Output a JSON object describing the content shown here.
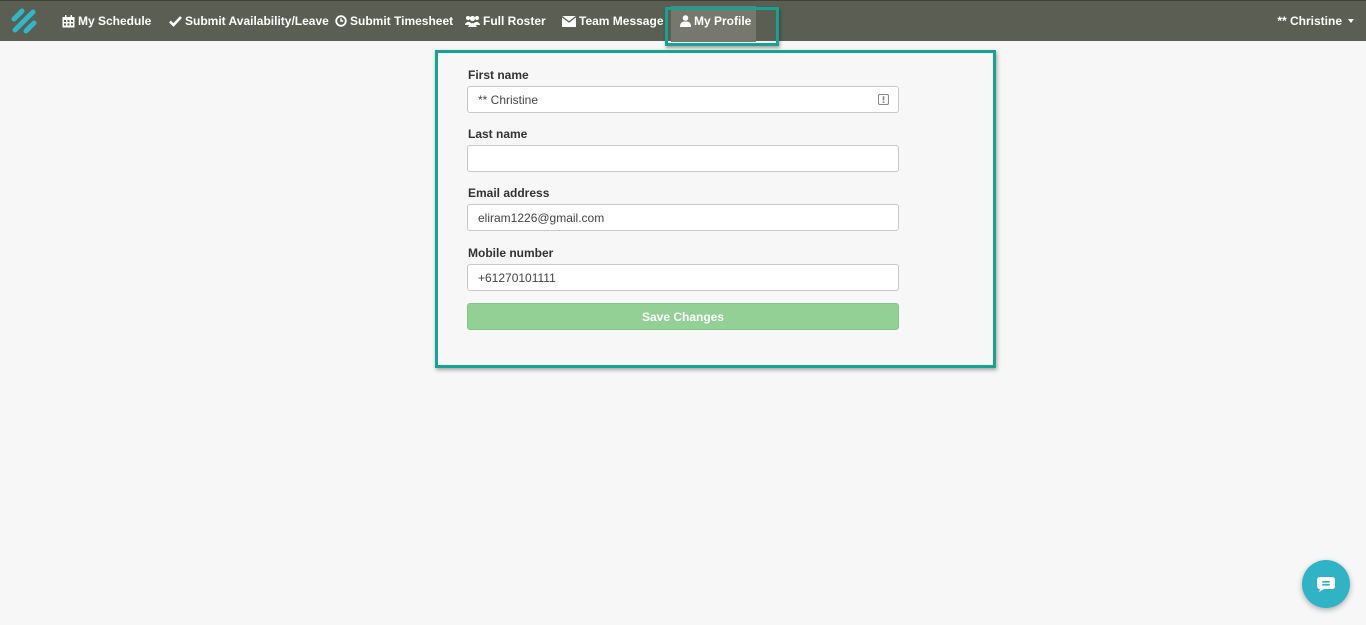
{
  "nav": {
    "items": [
      {
        "label": "My Schedule",
        "icon": "calendar-icon"
      },
      {
        "label": "Submit Availability/Leave",
        "icon": "check-icon"
      },
      {
        "label": "Submit Timesheet",
        "icon": "clock-icon"
      },
      {
        "label": "Full Roster",
        "icon": "users-icon"
      },
      {
        "label": "Team Message",
        "icon": "envelope-icon"
      },
      {
        "label": "My Profile",
        "icon": "user-icon",
        "active": true
      }
    ],
    "user_menu_label": "** Christine"
  },
  "profile_form": {
    "first_name_label": "First name",
    "first_name_value": "** Christine",
    "last_name_label": "Last name",
    "last_name_value": "",
    "email_label": "Email address",
    "email_value": "eliram1226@gmail.com",
    "mobile_label": "Mobile number",
    "mobile_value": "+61270101111",
    "save_label": "Save Changes"
  },
  "colors": {
    "navbar": "#5b5e52",
    "highlight": "#15a392",
    "save_button": "#93d096",
    "chat_button": "#2fb3c5",
    "logo": "#2fb8c8"
  },
  "icons": {
    "logo": "brand-logo",
    "password_manager": "password-manager-icon",
    "chat": "chat-bubble-icon"
  }
}
